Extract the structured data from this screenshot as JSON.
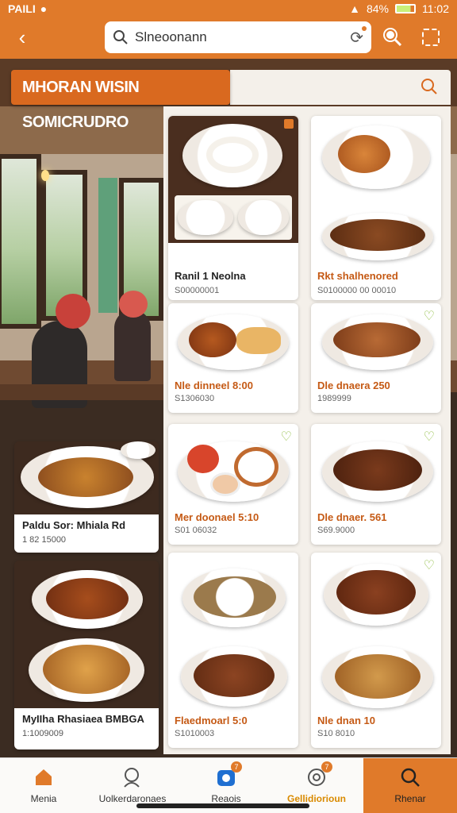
{
  "status_bar": {
    "carrier": "PAILI",
    "battery": "84%",
    "time": "11:02"
  },
  "search": {
    "query": "Slneoonann"
  },
  "banner": {
    "title": "MHORAN WISIN SOMICRUDRO"
  },
  "left_cards": [
    {
      "name": "Paldu Sor: Mhiala Rd",
      "price": "1 82 15000"
    },
    {
      "name": "MyIIha Rhasiaea BMBGA",
      "price": "1:1009009"
    }
  ],
  "menu_cards": [
    {
      "title": "Ranil 1 Neolna",
      "subtitle": "S00000001"
    },
    {
      "title": "Rkt shalhenored",
      "subtitle": "S0100000 00 00010"
    },
    {
      "title": "Nle dinneel 8:00",
      "subtitle": "S1306030"
    },
    {
      "title": "Dle dnaera 250",
      "subtitle": "1989999"
    },
    {
      "title": "Mer doonael 5:10",
      "subtitle": "S01 06032"
    },
    {
      "title": "Dle dnaer. 561",
      "subtitle": "S69.9000"
    },
    {
      "title": "Flaedmoarl 5:0",
      "subtitle": "S1010003"
    },
    {
      "title": "Nle dnan 10",
      "subtitle": "S10 8010"
    }
  ],
  "bottom_nav": [
    {
      "label": "Menia",
      "icon": "home-icon"
    },
    {
      "label": "Uolkerdaronaes",
      "icon": "profile-search-icon"
    },
    {
      "label": "Reaois",
      "icon": "camera-icon",
      "badge": "7"
    },
    {
      "label": "Gellidiorioun",
      "icon": "location-icon",
      "badge": "7"
    },
    {
      "label": "Rhenar",
      "icon": "search-icon"
    }
  ],
  "colors": {
    "brand": "#e07a2a",
    "card_title": "#c55a15",
    "heart": "#8dbb3c"
  }
}
